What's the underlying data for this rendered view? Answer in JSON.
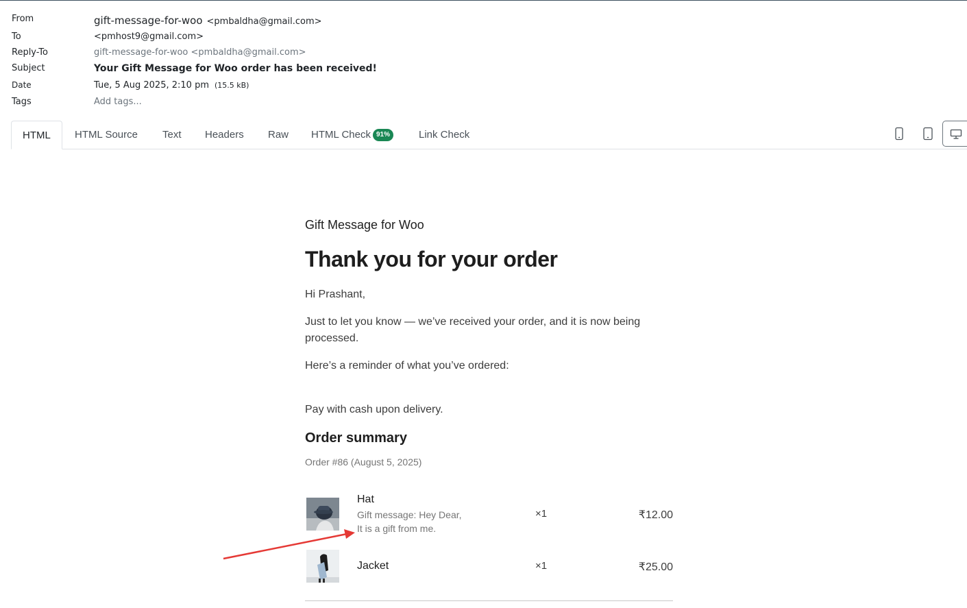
{
  "headers": {
    "from_label": "From",
    "from_name": "gift-message-for-woo",
    "from_addr": "<pmbaldha@gmail.com>",
    "to_label": "To",
    "to_value": "<pmhost9@gmail.com>",
    "replyto_label": "Reply-To",
    "replyto_value": "gift-message-for-woo <pmbaldha@gmail.com>",
    "subject_label": "Subject",
    "subject_value": "Your Gift Message for Woo order has been received!",
    "date_label": "Date",
    "date_value": "Tue, 5 Aug 2025, 2:10 pm",
    "size_value": "(15.5 kB)",
    "tags_label": "Tags",
    "tags_placeholder": "Add tags..."
  },
  "tabs": [
    {
      "label": "HTML",
      "active": true
    },
    {
      "label": "HTML Source"
    },
    {
      "label": "Text"
    },
    {
      "label": "Headers"
    },
    {
      "label": "Raw"
    },
    {
      "label": "HTML Check",
      "badge": "91%"
    },
    {
      "label": "Link Check"
    }
  ],
  "device_icons": [
    "mobile-icon",
    "tablet-icon",
    "desktop-icon"
  ],
  "email": {
    "site_title": "Gift Message for Woo",
    "heading": "Thank you for your order",
    "greeting": "Hi Prashant,",
    "intro": "Just to let you know — we’ve received your order, and it is now being processed.",
    "reminder": "Here’s a reminder of what you’ve ordered:",
    "payment": "Pay with cash upon delivery.",
    "summary_title": "Order summary",
    "order_meta": "Order #86 (August 5, 2025)",
    "items": [
      {
        "name": "Hat",
        "gift_line1": "Gift message: Hey Dear,",
        "gift_line2": "It is a gift from me.",
        "qty": "×1",
        "price": "₹12.00"
      },
      {
        "name": "Jacket",
        "qty": "×1",
        "price": "₹25.00"
      }
    ]
  },
  "colors": {
    "badge": "#198754",
    "annotation_arrow": "#e53935"
  }
}
